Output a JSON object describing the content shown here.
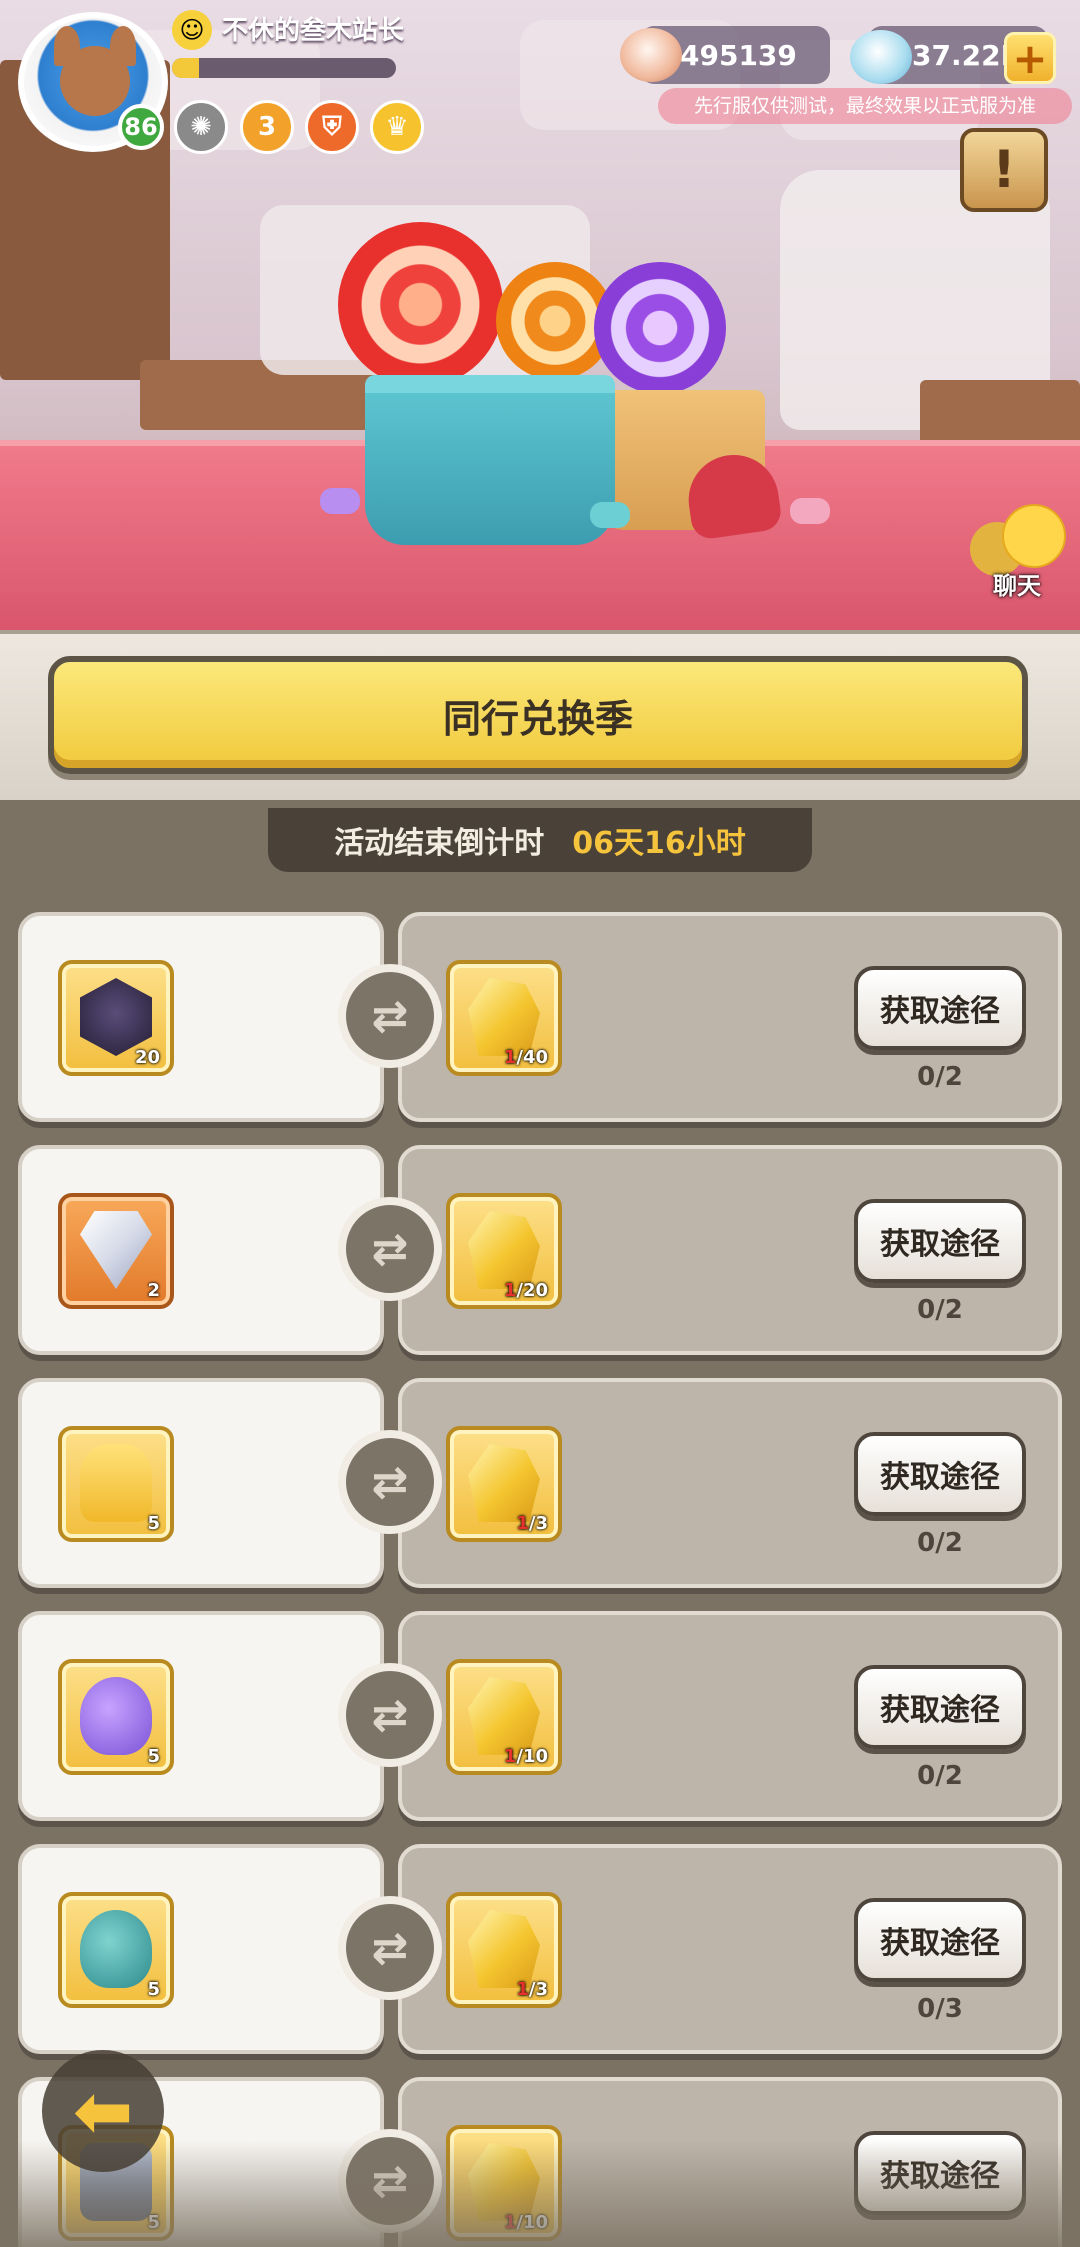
{
  "player": {
    "name": "不休的叁木站长",
    "level": "86",
    "exp_progress": 0.12
  },
  "badges": [
    {
      "icon": "gear-badge-icon",
      "color": "#8a8a8a",
      "glyph": "✺"
    },
    {
      "icon": "orange-badge-icon",
      "color": "#f2a12a",
      "glyph": "3"
    },
    {
      "icon": "shield-badge-icon",
      "color": "#ee6a2a",
      "glyph": "⛨"
    },
    {
      "icon": "crown-badge-icon",
      "color": "#f6c22e",
      "glyph": "♛"
    }
  ],
  "currencies": {
    "coins": "495139",
    "gems": "37.22M"
  },
  "notice": "先行服仅供测试，最终效果以正式服为准",
  "quest_glyph": "!",
  "chat": {
    "label": "聊天"
  },
  "event": {
    "title": "同行兑换季",
    "countdown_label": "活动结束倒计时",
    "countdown_value": "06天16小时"
  },
  "swap_glyph": "⇄",
  "get_button_label": "获取途径",
  "exchanges": [
    {
      "reward_icon": "warrior-card-icon",
      "reward_count": "20",
      "slot_style": "gold",
      "cost_icon": "gold-ore-icon",
      "have": "1",
      "need": "/40",
      "limit": "0/2"
    },
    {
      "reward_icon": "diamond-icon",
      "reward_count": "2",
      "slot_style": "orange",
      "cost_icon": "gold-ore-icon",
      "have": "1",
      "need": "/20",
      "limit": "0/2"
    },
    {
      "reward_icon": "golden-totem-icon",
      "reward_count": "5",
      "slot_style": "gold",
      "cost_icon": "gold-ore-icon",
      "have": "1",
      "need": "/3",
      "limit": "0/2"
    },
    {
      "reward_icon": "purple-bag-icon",
      "reward_count": "5",
      "slot_style": "gold",
      "cost_icon": "gold-ore-icon",
      "have": "1",
      "need": "/10",
      "limit": "0/2"
    },
    {
      "reward_icon": "teal-bag-icon",
      "reward_count": "5",
      "slot_style": "gold",
      "cost_icon": "gold-ore-icon",
      "have": "1",
      "need": "/3",
      "limit": "0/3"
    },
    {
      "reward_icon": "treasure-chest-icon",
      "reward_count": "5",
      "slot_style": "gold",
      "cost_icon": "gold-ore-icon",
      "have": "1",
      "need": "/10",
      "limit": ""
    }
  ],
  "back_glyph": "⬅"
}
